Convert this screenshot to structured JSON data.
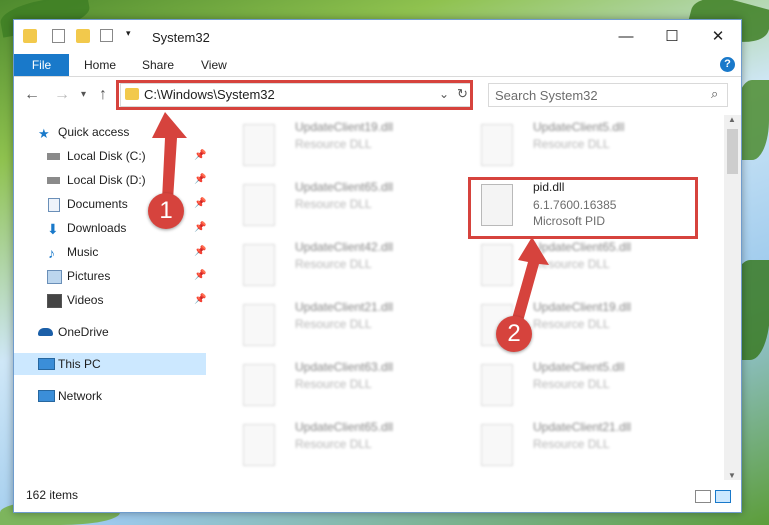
{
  "window": {
    "title": "System32",
    "minimize_icon": "minimize-icon",
    "maximize_icon": "maximize-icon",
    "close_icon": "close-icon"
  },
  "ribbon": {
    "tabs": [
      "File",
      "Home",
      "Share",
      "View"
    ],
    "help": "?"
  },
  "address": {
    "path": "C:\\Windows\\System32",
    "search_placeholder": "Search System32"
  },
  "nav": {
    "items": [
      {
        "label": "Quick access",
        "icon": "star-icon"
      },
      {
        "label": "Local Disk (C:)",
        "icon": "drive-icon"
      },
      {
        "label": "Local Disk (D:)",
        "icon": "drive-icon"
      },
      {
        "label": "Documents",
        "icon": "documents-icon"
      },
      {
        "label": "Downloads",
        "icon": "download-arrow-icon"
      },
      {
        "label": "Music",
        "icon": "music-note-icon"
      },
      {
        "label": "Pictures",
        "icon": "pictures-icon"
      },
      {
        "label": "Videos",
        "icon": "videos-icon"
      },
      {
        "label": "OneDrive",
        "icon": "cloud-icon"
      },
      {
        "label": "This PC",
        "icon": "computer-icon"
      },
      {
        "label": "Network",
        "icon": "network-icon"
      }
    ]
  },
  "files": {
    "left": [
      {
        "name": "UpdateClient19.dll",
        "type": "Resource DLL"
      },
      {
        "name": "UpdateClient65.dll",
        "type": "Resource DLL"
      },
      {
        "name": "UpdateClient42.dll",
        "type": "Resource DLL"
      },
      {
        "name": "UpdateClient21.dll",
        "type": "Resource DLL"
      },
      {
        "name": "UpdateClient63.dll",
        "type": "Resource DLL"
      },
      {
        "name": "UpdateClient65.dll",
        "type": "Resource DLL"
      }
    ],
    "right": [
      {
        "name": "UpdateClient5.dll",
        "type": "Resource DLL"
      },
      {
        "name": "UpdateClient65.dll",
        "type": "Resource DLL"
      },
      {
        "name": "UpdateClient19.dll",
        "type": "Resource DLL"
      },
      {
        "name": "UpdateClient5.dll",
        "type": "Resource DLL"
      },
      {
        "name": "UpdateClient21.dll",
        "type": "Resource DLL"
      }
    ],
    "highlighted": {
      "name": "pid.dll",
      "version": "6.1.7600.16385",
      "description": "Microsoft PID"
    }
  },
  "status": {
    "count": "162 items"
  },
  "annotations": {
    "step1": "1",
    "step2": "2",
    "accent": "#d6433d"
  }
}
